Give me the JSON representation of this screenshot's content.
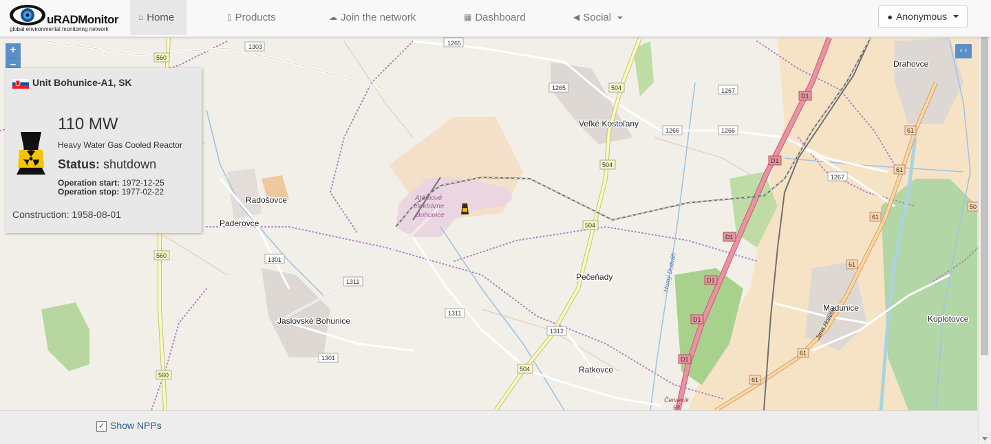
{
  "brand": {
    "title": "uRADMonitor",
    "subtitle": "global environmental monitoring network"
  },
  "nav": {
    "home": "Home",
    "products": "Products",
    "join": "Join the network",
    "dashboard": "Dashboard",
    "social": "Social"
  },
  "user": {
    "label": "Anonymous"
  },
  "map_controls": {
    "zoom_in": "+",
    "zoom_out": "−",
    "panel_toggle": "‹ ›"
  },
  "plant": {
    "name": "Unit Bohunice-A1, SK",
    "power": "110 MW",
    "reactor_type": "Heavy Water Gas Cooled Reactor",
    "status_label": "Status:",
    "status_value": "shutdown",
    "op_start_label": "Operation start:",
    "op_start_value": "1972-12-25",
    "op_stop_label": "Operation stop:",
    "op_stop_value": "1977-02-22",
    "construction": "Construction: 1958-08-01"
  },
  "map_labels": {
    "places": [
      "Radošovce",
      "Paderovce",
      "Jaslovské Bohunice",
      "Veľké Kostoľany",
      "Pečeňady",
      "Ratkovce",
      "Madunice",
      "Koplotovce",
      "Drahovce"
    ],
    "plant_label": [
      "Atómové",
      "elektrárne",
      "Bohunice"
    ],
    "roads": [
      "1303",
      "560",
      "1265",
      "1265",
      "504",
      "1267",
      "1266",
      "1266",
      "504",
      "1267",
      "504",
      "560",
      "1301",
      "1311",
      "1311",
      "1312",
      "1301",
      "560",
      "504",
      "D1",
      "D1",
      "D1",
      "D1",
      "D1",
      "D1",
      "61",
      "61",
      "61",
      "61",
      "61",
      "61",
      "50"
    ],
    "streams": [
      "Horný Dudváh",
      "Jana Hollého",
      "Červeník",
      "68"
    ]
  },
  "footer": {
    "show_npps": "Show NPPs",
    "checked": true
  },
  "colors": {
    "accent": "#5a8fc8",
    "motorway": "#e892a2",
    "primary_road": "#fcd6a4",
    "secondary_road": "#f7fabf",
    "boundary": "#b07fc0"
  }
}
